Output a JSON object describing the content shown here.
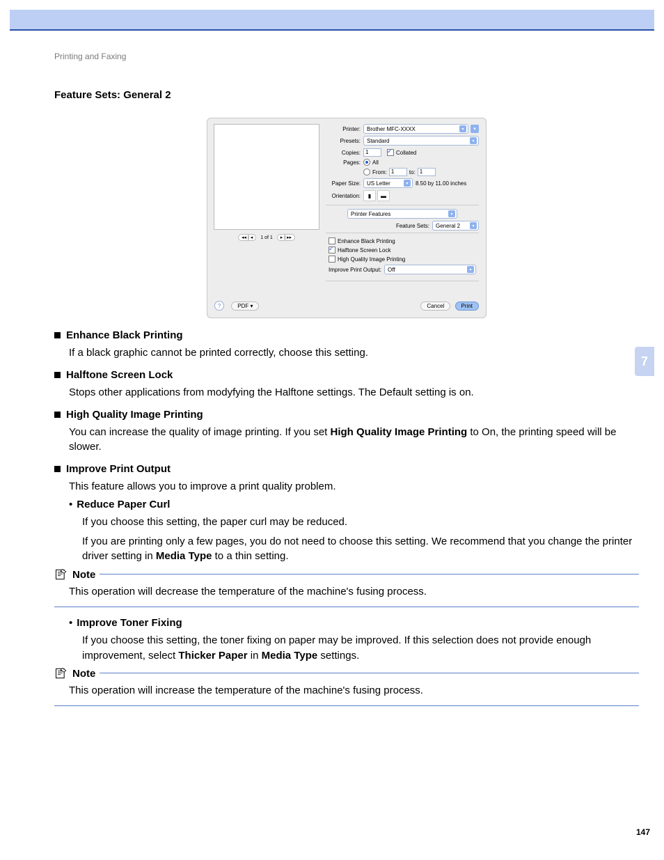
{
  "breadcrumb": "Printing and Faxing",
  "section_title": "Feature Sets: General 2",
  "chapter_number": "7",
  "page_number": "147",
  "dialog": {
    "printer": {
      "label": "Printer:",
      "value": "Brother MFC-XXXX"
    },
    "presets": {
      "label": "Presets:",
      "value": "Standard"
    },
    "copies": {
      "label": "Copies:",
      "value": "1",
      "collated": "Collated"
    },
    "pages": {
      "label": "Pages:",
      "all": "All",
      "from_label": "From:",
      "from": "1",
      "to_label": "to:",
      "to": "1"
    },
    "paper": {
      "label": "Paper Size:",
      "value": "US Letter",
      "dims": "8.50 by 11.00 inches"
    },
    "orient": {
      "label": "Orientation:"
    },
    "section_drop": "Printer Features",
    "feature_sets": {
      "label": "Feature Sets:",
      "value": "General 2"
    },
    "cb": {
      "enhance": "Enhance Black Printing",
      "halftone": "Halftone Screen Lock",
      "hq": "High Quality Image Printing"
    },
    "improve": {
      "label": "Improve Print Output:",
      "value": "Off"
    },
    "pager": "1 of 1",
    "footer": {
      "pdf": "PDF ▾",
      "cancel": "Cancel",
      "print": "Print"
    }
  },
  "items": {
    "enhance": {
      "head": "Enhance Black Printing",
      "desc": "If a black graphic cannot be printed correctly, choose this setting."
    },
    "halftone": {
      "head": "Halftone Screen Lock",
      "desc": "Stops other applications from modyfying the Halftone settings. The Default setting is on."
    },
    "hq": {
      "head": "High Quality Image Printing",
      "desc_a": "You can increase the quality of image printing. If you set ",
      "desc_b": "High Quality Image Printing",
      "desc_c": " to On, the printing speed will be slower."
    },
    "improve": {
      "head": "Improve Print Output",
      "desc": "This feature allows you to improve a print quality problem.",
      "reduce": {
        "head": "Reduce Paper Curl",
        "d1": "If you choose this setting, the paper curl may be reduced.",
        "d2a": "If you are printing only a few pages, you do not need to choose this setting. We recommend that you change the printer driver setting in ",
        "d2b": "Media Type",
        "d2c": " to a thin setting."
      },
      "toner": {
        "head": "Improve Toner Fixing",
        "d1a": "If you choose this setting, the toner fixing on paper may be improved. If this selection does not provide enough improvement, select ",
        "d1b": "Thicker Paper",
        "d1c": " in ",
        "d1d": "Media Type",
        "d1e": " settings."
      }
    }
  },
  "notes": {
    "label": "Note",
    "n1": "This operation will decrease the temperature of the machine's fusing process.",
    "n2": "This operation will increase the temperature of the machine's fusing process."
  }
}
